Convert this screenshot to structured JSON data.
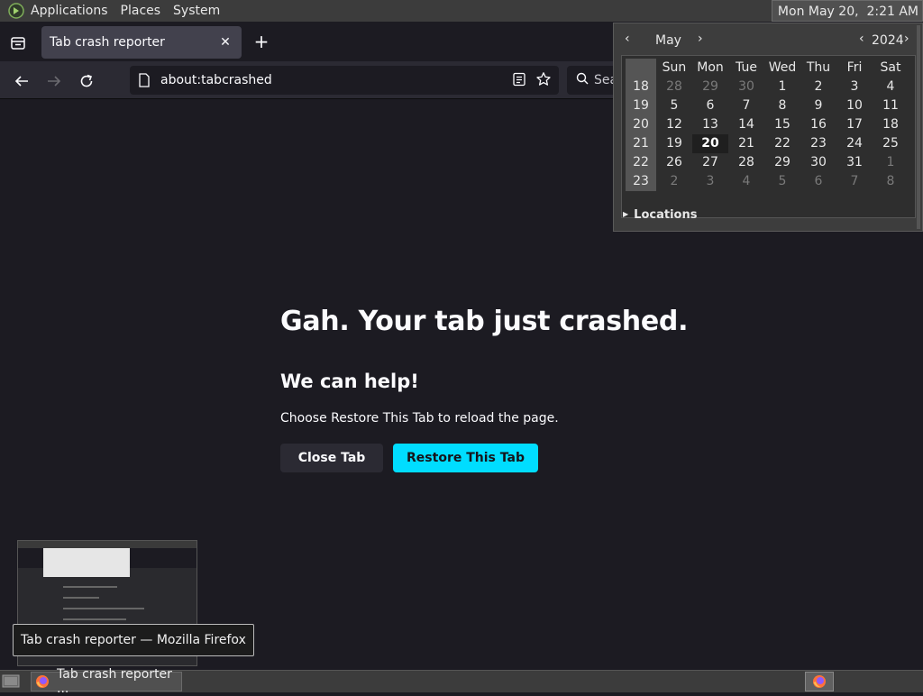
{
  "panel": {
    "menus": [
      "Applications",
      "Places",
      "System"
    ],
    "clock": "Mon May 20,  2:21 AM"
  },
  "browser": {
    "tab_title": "Tab crash reporter",
    "url": "about:tabcrashed",
    "search_placeholder": "Sea"
  },
  "crash_page": {
    "title": "Gah. Your tab just crashed.",
    "subtitle": "We can help!",
    "message": "Choose Restore This Tab to reload the page.",
    "close_button": "Close Tab",
    "restore_button": "Restore This Tab"
  },
  "tooltip": "Tab crash reporter — Mozilla Firefox",
  "taskbar": {
    "task_label": "Tab crash reporter ..."
  },
  "calendar": {
    "month": "May",
    "year": "2024",
    "weekdays": [
      "Sun",
      "Mon",
      "Tue",
      "Wed",
      "Thu",
      "Fri",
      "Sat"
    ],
    "weeks": [
      {
        "wk": "18",
        "days": [
          "28",
          "29",
          "30",
          "1",
          "2",
          "3",
          "4"
        ],
        "dim": [
          0,
          1,
          2
        ]
      },
      {
        "wk": "19",
        "days": [
          "5",
          "6",
          "7",
          "8",
          "9",
          "10",
          "11"
        ],
        "dim": []
      },
      {
        "wk": "20",
        "days": [
          "12",
          "13",
          "14",
          "15",
          "16",
          "17",
          "18"
        ],
        "dim": []
      },
      {
        "wk": "21",
        "days": [
          "19",
          "20",
          "21",
          "22",
          "23",
          "24",
          "25"
        ],
        "dim": [],
        "today": 1
      },
      {
        "wk": "22",
        "days": [
          "26",
          "27",
          "28",
          "29",
          "30",
          "31",
          "1"
        ],
        "dim": [
          6
        ]
      },
      {
        "wk": "23",
        "days": [
          "2",
          "3",
          "4",
          "5",
          "6",
          "7",
          "8"
        ],
        "dim": [
          0,
          1,
          2,
          3,
          4,
          5,
          6
        ]
      }
    ],
    "locations_label": "Locations"
  },
  "colors": {
    "accent": "#00ddff",
    "background": "#1c1b22",
    "toolbar": "#2b2a33"
  }
}
